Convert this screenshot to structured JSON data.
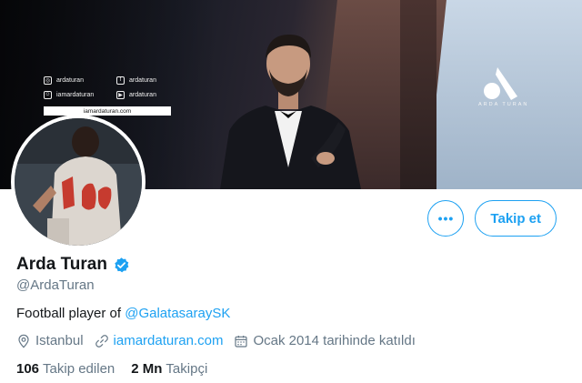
{
  "banner": {
    "social": {
      "instagram": "ardaturan",
      "facebook": "ardaturan",
      "snapchat": "iamardaturan",
      "youtube": "ardaturan",
      "website": "iamardaturan.com"
    },
    "brand_text": "ARDA TURAN"
  },
  "actions": {
    "more_label": "•••",
    "follow_label": "Takip et"
  },
  "profile": {
    "display_name": "Arda Turan",
    "handle": "@ArdaTuran",
    "bio_prefix": "Football player of ",
    "bio_mention": "@GalatasaraySK",
    "location": "Istanbul",
    "website": "iamardaturan.com",
    "joined": "Ocak 2014 tarihinde katıldı"
  },
  "stats": {
    "following_count": "106",
    "following_label": "Takip edilen",
    "followers_count": "2 Mn",
    "followers_label": "Takipçi"
  },
  "colors": {
    "accent": "#1da1f2",
    "secondary_text": "#657786",
    "primary_text": "#14171a"
  }
}
